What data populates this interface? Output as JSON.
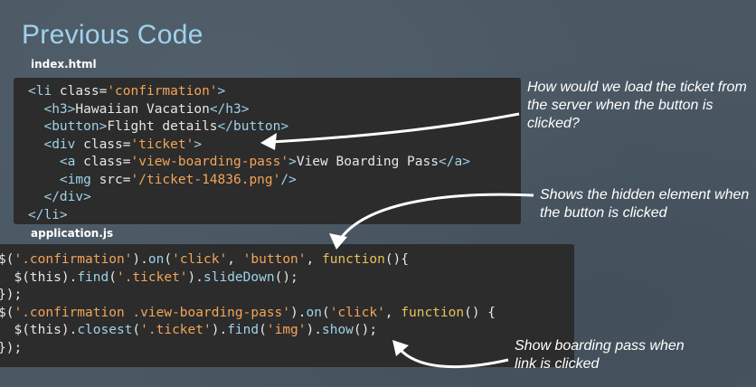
{
  "title": "Previous Code",
  "files": {
    "html_name": "index.html",
    "js_name": "application.js"
  },
  "html_code": [
    "<li class='confirmation'>",
    "  <h3>Hawaiian Vacation</h3>",
    "  <button>Flight details</button>",
    "  <div class='ticket'>",
    "    <a class='view-boarding-pass'>View Boarding Pass</a>",
    "    <img src='/ticket-14836.png'/>",
    "  </div>",
    "</li>"
  ],
  "js_code": [
    "$('.confirmation').on('click', 'button', function(){",
    "  $(this).find('.ticket').slideDown();",
    "});",
    "$('.confirmation .view-boarding-pass').on('click', function() {",
    "  $(this).closest('.ticket').find('img').show();",
    "});"
  ],
  "annotations": {
    "load_ticket": "How would we load the ticket from the server when the button is clicked?",
    "shows_hidden": "Shows the hidden element when the button is clicked",
    "show_pass": "Show boarding pass when link is clicked"
  },
  "colors": {
    "title": "#9fd2ea",
    "tag": "#9fd2ea",
    "string": "#f2a55a",
    "keyword": "#e7c35a",
    "code_bg": "#2c2c2c",
    "background": "#4a5864"
  }
}
